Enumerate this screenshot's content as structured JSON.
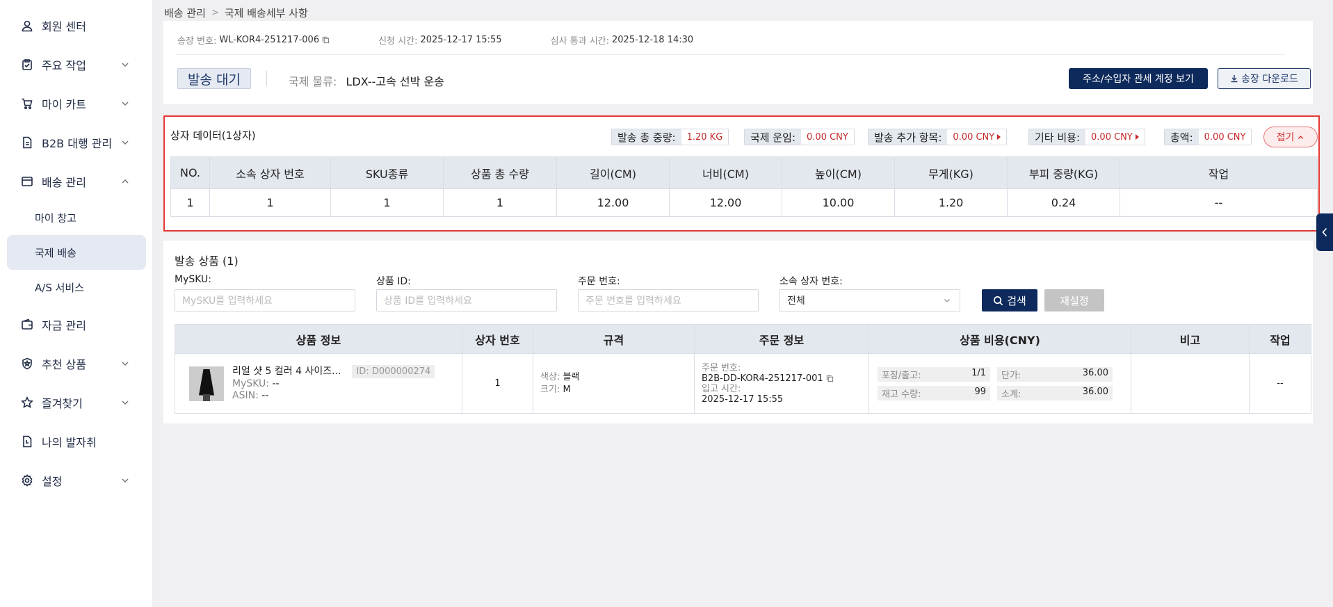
{
  "sidebar": {
    "items": [
      {
        "label": "회원 센터"
      },
      {
        "label": "주요 작업"
      },
      {
        "label": "마이 카트"
      },
      {
        "label": "B2B 대행 관리"
      },
      {
        "label": "배송 관리"
      },
      {
        "label": "자금 관리"
      },
      {
        "label": "추천 상품"
      },
      {
        "label": "즐겨찾기"
      },
      {
        "label": "나의 발자취"
      },
      {
        "label": "설정"
      }
    ],
    "sub_items": [
      {
        "label": "마이 창고"
      },
      {
        "label": "국제 배송",
        "active": true
      },
      {
        "label": "A/S 서비스"
      }
    ]
  },
  "breadcrumb": {
    "parent": "배송 관리",
    "current": "국제 배송세부 사항"
  },
  "header": {
    "invoice_label": "송장 번호:",
    "invoice_value": "WL-KOR4-251217-006",
    "apply_label": "신청 시간:",
    "apply_value": "2025-12-17 15:55",
    "review_label": "심사 통과 시간:",
    "review_value": "2025-12-18 14:30",
    "status": "발송 대기",
    "logistics_label": "국제 물류:",
    "logistics_value": "LDX--고속 선박 운송",
    "btn_address": "주소/수입자 관세 계정 보기",
    "btn_download": "송장 다운로드"
  },
  "box_data": {
    "title": "상자 데이터(1상자)",
    "summary": [
      {
        "label": "발송 총 중량:",
        "value": "1.20 KG",
        "arrow": false
      },
      {
        "label": "국제 운임:",
        "value": "0.00 CNY",
        "arrow": false
      },
      {
        "label": "발송 추가 항목:",
        "value": "0.00 CNY",
        "arrow": true
      },
      {
        "label": "기타 비용:",
        "value": "0.00 CNY",
        "arrow": true
      },
      {
        "label": "총액:",
        "value": "0.00 CNY",
        "arrow": false
      }
    ],
    "fold_label": "접기",
    "columns": [
      "NO.",
      "소속 상자 번호",
      "SKU종류",
      "상품 총 수량",
      "길이(CM)",
      "너비(CM)",
      "높이(CM)",
      "무게(KG)",
      "부피 중량(KG)",
      "작업"
    ],
    "rows": [
      [
        "1",
        "1",
        "1",
        "1",
        "12.00",
        "12.00",
        "10.00",
        "1.20",
        "0.24",
        "--"
      ]
    ]
  },
  "products": {
    "title": "발송 상품 (1)",
    "filters": {
      "mysku_label": "MySKU:",
      "mysku_placeholder": "MySKU를 입력하세요",
      "pid_label": "상품 ID:",
      "pid_placeholder": "상품 ID를 입력하세요",
      "order_label": "주문 번호:",
      "order_placeholder": "주문 번호를 입력하세요",
      "box_label": "소속 상자 번호:",
      "box_value": "전체"
    },
    "search_label": "검색",
    "reset_label": "재설정",
    "columns": [
      "상품 정보",
      "상자 번호",
      "규격",
      "주문 정보",
      "상품 비용(CNY)",
      "비고",
      "작업"
    ],
    "row": {
      "name": "리얼 샷 5 컬러 4 사이즈...",
      "id": "ID: D000000274",
      "mysku_label": "MySKU:",
      "mysku_value": "--",
      "asin_label": "ASIN:",
      "asin_value": "--",
      "box_no": "1",
      "color_label": "색상:",
      "color_value": "블랙",
      "size_label": "크기:",
      "size_value": "M",
      "order_no_label": "주문 번호:",
      "order_no_value": "B2B-DD-KOR4-251217-001",
      "inbound_label": "입고 시간:",
      "inbound_value": "2025-12-17 15:55",
      "pack_label": "포장/출고:",
      "pack_value": "1/1",
      "unit_label": "단가:",
      "unit_value": "36.00",
      "stock_label": "재고 수량:",
      "stock_value": "99",
      "subtotal_label": "소계:",
      "subtotal_value": "36.00",
      "remark": "",
      "action": "--"
    }
  },
  "colors": {
    "primary": "#0e2a5c",
    "danger": "#e53935",
    "header_bg": "#e3e7ee"
  }
}
